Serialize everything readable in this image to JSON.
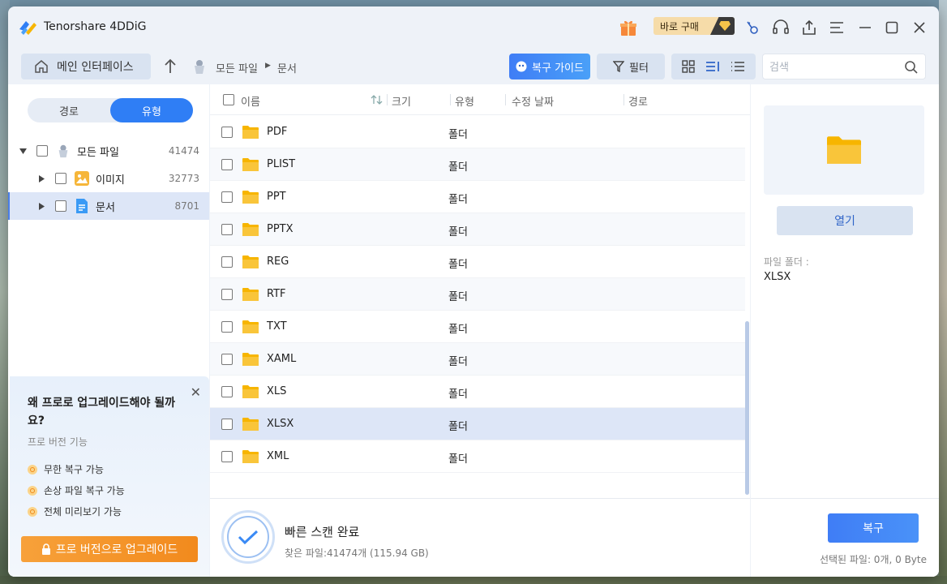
{
  "app": {
    "title": "Tenorshare 4DDiG"
  },
  "titlebar": {
    "buy_label": "바로 구매",
    "icons": [
      "gift-icon",
      "key-icon",
      "headset-icon",
      "share-icon",
      "menu-icon",
      "minimize-icon",
      "maximize-icon",
      "close-icon"
    ]
  },
  "toolbar": {
    "home_label": "메인 인터페이스",
    "breadcrumb": {
      "root": "모든 파일",
      "current": "문서"
    },
    "guide_label": "복구 가이드",
    "filter_label": "필터",
    "search_placeholder": "검색"
  },
  "sidebar": {
    "tabs": [
      {
        "label": "경로",
        "active": false
      },
      {
        "label": "유형",
        "active": true
      }
    ],
    "tree": [
      {
        "label": "모든 파일",
        "count": "41474"
      },
      {
        "label": "이미지",
        "count": "32773"
      },
      {
        "label": "문서",
        "count": "8701"
      }
    ]
  },
  "promo": {
    "title": "왜 프로로 업그레이드해야 될까요?",
    "subtitle": "프로 버전 기능",
    "features": [
      "무한 복구 가능",
      "손상 파일 복구 가능",
      "전체 미리보기 가능"
    ],
    "button": "프로 버전으로 업그레이드"
  },
  "table": {
    "headers": {
      "name": "이름",
      "size": "크기",
      "type": "유형",
      "modified": "수정 날짜",
      "path": "경로"
    },
    "rows": [
      {
        "name": "PDF",
        "type": "폴더"
      },
      {
        "name": "PLIST",
        "type": "폴더"
      },
      {
        "name": "PPT",
        "type": "폴더"
      },
      {
        "name": "PPTX",
        "type": "폴더"
      },
      {
        "name": "REG",
        "type": "폴더"
      },
      {
        "name": "RTF",
        "type": "폴더"
      },
      {
        "name": "TXT",
        "type": "폴더"
      },
      {
        "name": "XAML",
        "type": "폴더"
      },
      {
        "name": "XLS",
        "type": "폴더"
      },
      {
        "name": "XLSX",
        "type": "폴더"
      },
      {
        "name": "XML",
        "type": "폴더"
      }
    ]
  },
  "preview": {
    "open_label": "열기",
    "folder_label": "파일 폴더 :",
    "folder_value": "XLSX"
  },
  "status": {
    "title": "빠른 스캔 완료",
    "found": "찾은 파일:41474개 (115.94 GB)",
    "recover_label": "복구",
    "selected": "선택된 파일: 0개, 0 Byte"
  },
  "colors": {
    "accent": "#2f7ef5",
    "folder": "#f7b500",
    "upgrade": "#f28a1d",
    "selected_row": "#dde6f7"
  }
}
